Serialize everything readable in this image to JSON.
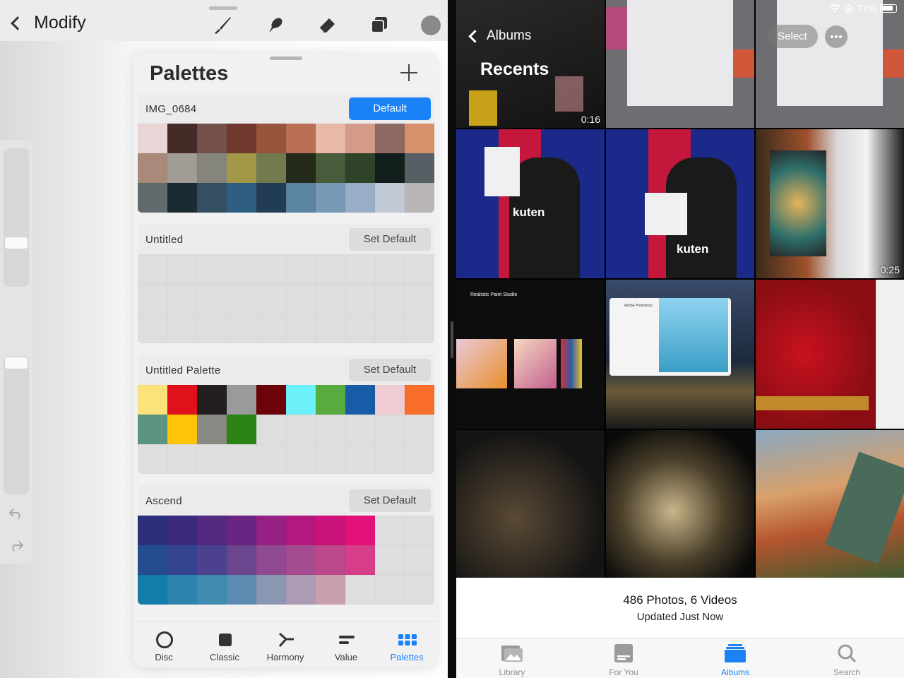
{
  "procreate": {
    "back_label": "Modify",
    "panel_title": "Palettes",
    "palettes": [
      {
        "name": "IMG_0684",
        "button": "Default",
        "is_default": true,
        "colors": [
          "#e8d6d6",
          "#452b27",
          "#73514a",
          "#71382e",
          "#97553e",
          "#bb6f55",
          "#e8b9a6",
          "#d49c88",
          "#8d6961",
          "#d6906b",
          "#a98a7a",
          "#a29c97",
          "#85857e",
          "#a29847",
          "#727a4f",
          "#252b1b",
          "#485b3a",
          "#2f4328",
          "#121e1c",
          "#566064",
          "#616a6c",
          "#1a2b31",
          "#334f61",
          "#2e5f82",
          "#233c55",
          "#5c84a3",
          "#789ab7",
          "#98afc7",
          "#c1c8d6",
          "#bbb6b6"
        ]
      },
      {
        "name": "Untitled",
        "button": "Set Default",
        "is_default": false,
        "colors": []
      },
      {
        "name": "Untitled Palette",
        "button": "Set Default",
        "is_default": false,
        "colors": [
          "#fce27b",
          "#e0111a",
          "#231f20",
          "#9a9a9a",
          "#6b0308",
          "#6cf0fa",
          "#58ac3f",
          "#175ca6",
          "#eeccd2",
          "#f86d27",
          "#5b9581",
          "#fec405",
          "#898983",
          "#2a8312"
        ]
      },
      {
        "name": "Ascend",
        "button": "Set Default",
        "is_default": false,
        "colors": [
          "#2c2f7b",
          "#3c2a7d",
          "#542a80",
          "#6a2583",
          "#962184",
          "#b31880",
          "#cc137b",
          "#e3127a",
          "",
          "",
          "#244d8f",
          "#33438f",
          "#4c418f",
          "#6c458f",
          "#8f4a91",
          "#a54b8f",
          "#bc488b",
          "#d63e89",
          "",
          "",
          "#137ca8",
          "#2d85ad",
          "#3f8cb0",
          "#5c8cb1",
          "#8b96b3",
          "#ad9bb3",
          "#c79fae",
          "",
          "",
          ""
        ]
      }
    ],
    "tabs": [
      {
        "label": "Disc",
        "icon": "disc-icon"
      },
      {
        "label": "Classic",
        "icon": "classic-icon"
      },
      {
        "label": "Harmony",
        "icon": "harmony-icon"
      },
      {
        "label": "Value",
        "icon": "value-icon"
      },
      {
        "label": "Palettes",
        "icon": "palettes-icon",
        "active": true
      }
    ],
    "accent": "#1a82f7"
  },
  "photos": {
    "back_label": "Albums",
    "title": "Recents",
    "select_label": "Select",
    "status": {
      "battery": "77%"
    },
    "durations": [
      "0:16",
      "0:25"
    ],
    "summary_count": "486 Photos, 6 Videos",
    "summary_updated": "Updated Just Now",
    "screenshot_texts": {
      "app_title": "Realistic Paint Studio",
      "brand": "kuten",
      "ps_label": "Adobe Photoshop"
    },
    "tabs": [
      {
        "label": "Library",
        "icon": "library-icon"
      },
      {
        "label": "For You",
        "icon": "for-you-icon"
      },
      {
        "label": "Albums",
        "icon": "albums-icon",
        "active": true
      },
      {
        "label": "Search",
        "icon": "search-icon"
      }
    ]
  }
}
